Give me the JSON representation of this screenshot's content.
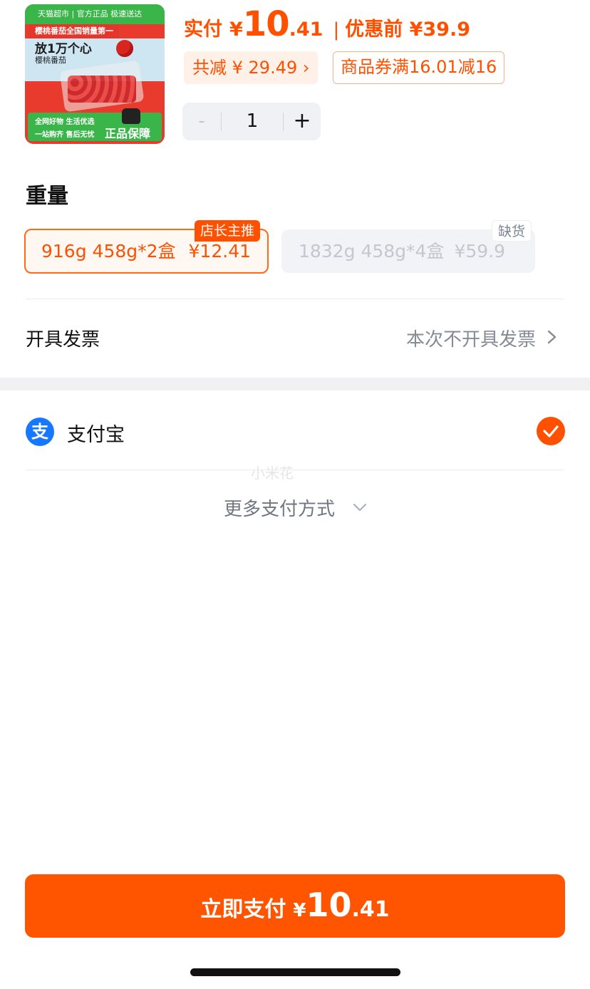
{
  "product_image": {
    "top_bar": "天猫超市 | 官方正品 极速送达",
    "badge": "樱桃番茄全国销量第一",
    "headline": "放1万个心",
    "subline": "樱桃番茄",
    "bottom_line1": "全网好物 生活优选",
    "bottom_line2": "一站购齐 售后无忧",
    "guarantee": "正品保障"
  },
  "price": {
    "pay_label": "实付",
    "currency": "¥",
    "integer": "10",
    "decimal": ".41",
    "separator": "|",
    "before_label": "优惠前 ¥39.9"
  },
  "promo": {
    "reduce_text": "共减 ¥ 29.49",
    "reduce_chevron": "›",
    "coupon_text": "商品券满16.01减16"
  },
  "stepper": {
    "minus": "-",
    "value": "1",
    "plus": "+"
  },
  "weight": {
    "title": "重量",
    "options": [
      {
        "spec": "916g 458g*2盒",
        "price": "¥12.41",
        "badge": "店长主推",
        "state": "selected"
      },
      {
        "spec": "1832g 458g*4盒",
        "price": "¥59.9",
        "badge": "缺货",
        "state": "out_of_stock"
      }
    ]
  },
  "invoice": {
    "label": "开具发票",
    "value": "本次不开具发票"
  },
  "payment": {
    "alipay_glyph": "支",
    "alipay_label": "支付宝",
    "watermark": "小米花",
    "more_label": "更多支付方式"
  },
  "pay_button": {
    "label": "立即支付",
    "currency": "¥",
    "integer": "10",
    "decimal": ".41"
  },
  "colors": {
    "accent": "#ff5000",
    "alipay_blue": "#1677ff",
    "muted_text": "#848b96"
  }
}
